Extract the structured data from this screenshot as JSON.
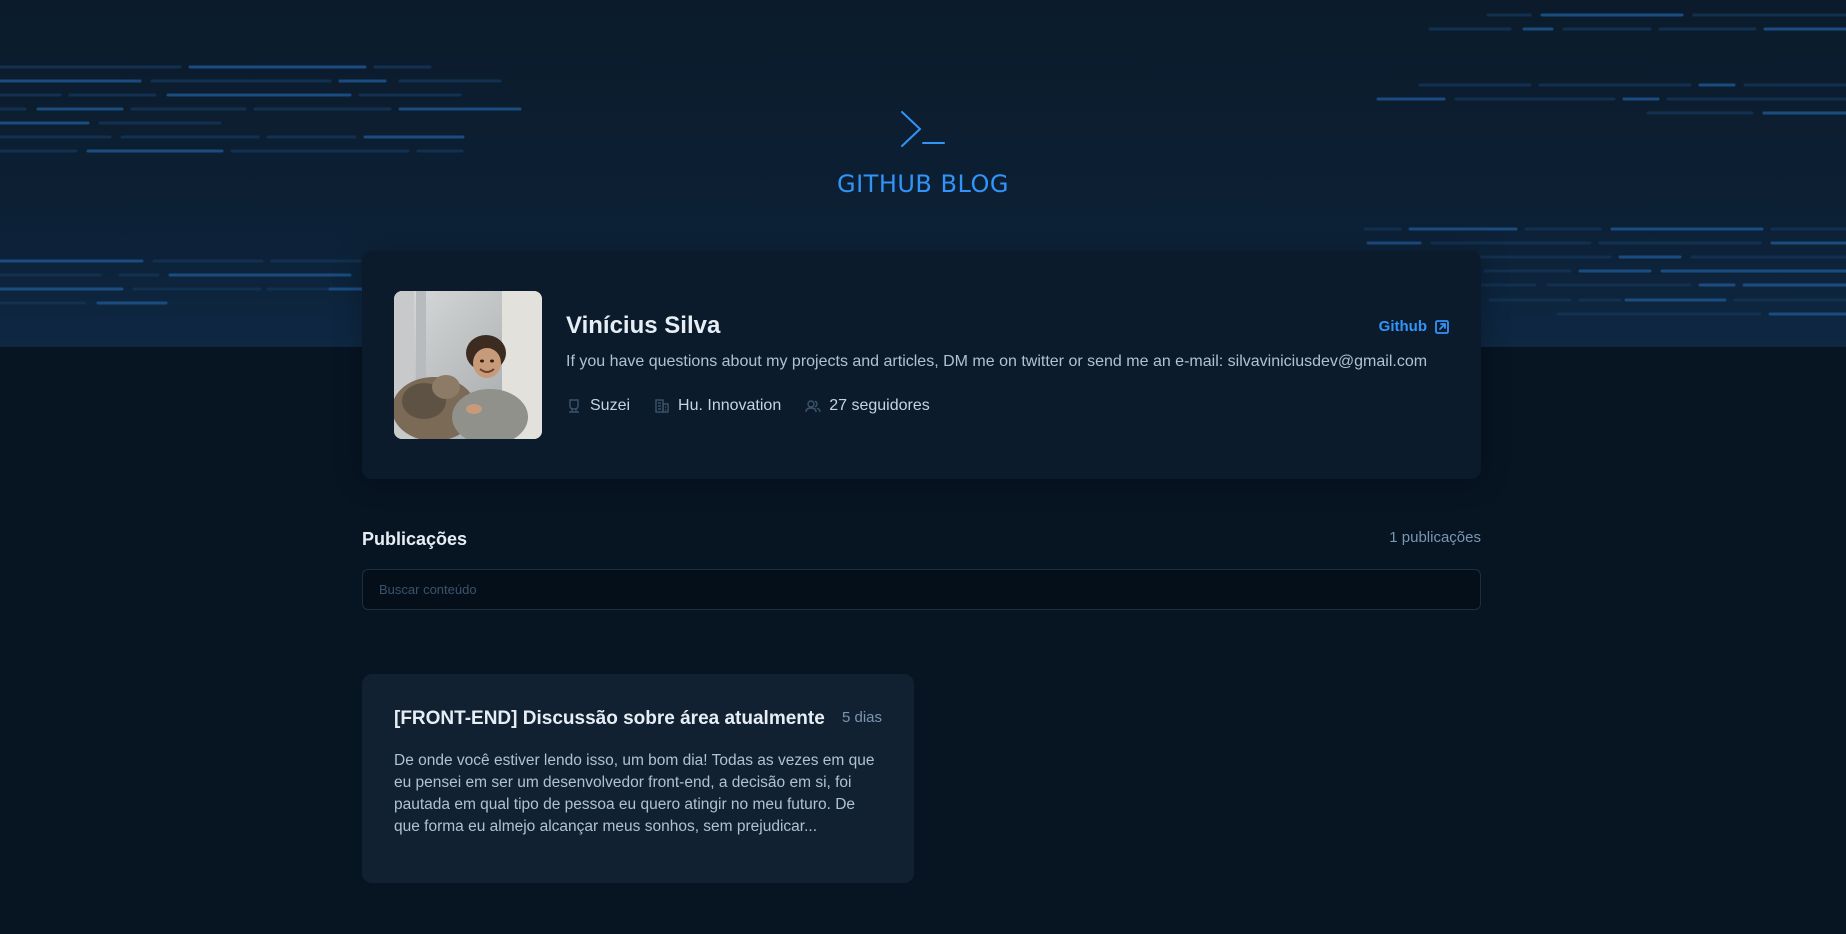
{
  "header": {
    "title": "GITHUB BLOG",
    "logo_icon": "terminal-prompt-icon"
  },
  "profile": {
    "name": "Vinícius Silva",
    "github_label": "Github",
    "github_icon": "external-link-icon",
    "bio": "If you have questions about my projects and articles, DM me on twitter or send me an e-mail: silvaviniciusdev@gmail.com",
    "meta": {
      "login": "Suzei",
      "company": "Hu. Innovation",
      "followers": "27 seguidores"
    }
  },
  "publications": {
    "title": "Publicações",
    "count": "1 publicações",
    "search_placeholder": "Buscar conteúdo",
    "posts": [
      {
        "title": "[FRONT-END] Discussão sobre área atualmente",
        "date": "5 dias",
        "excerpt": "De onde você estiver lendo isso, um bom dia! Todas as vezes em que eu pensei em ser um desenvolvedor front-end, a decisão em si, foi pautada em qual tipo de pessoa eu quero atingir no meu futuro. De que forma eu almejo alcançar meus sonhos, sem prejudicar..."
      }
    ]
  },
  "colors": {
    "brand": "#3294f8",
    "background": "#071422",
    "card": "#0b1b2b",
    "post_card": "#112131"
  }
}
